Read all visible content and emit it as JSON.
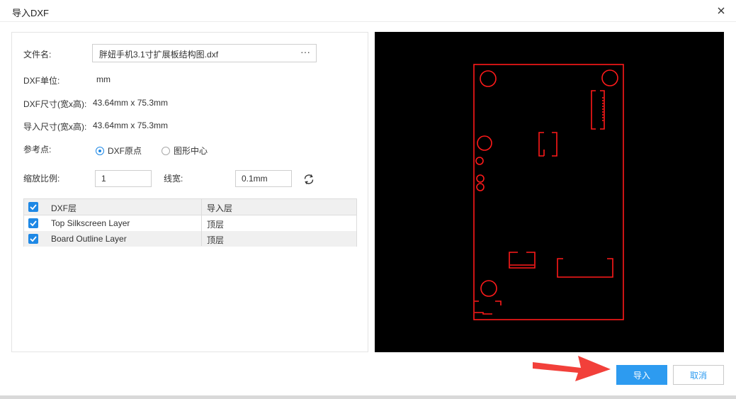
{
  "window": {
    "title": "导入DXF"
  },
  "form": {
    "file_label": "文件名:",
    "file_value": "胖妞手机3.1寸扩展板结构图.dxf",
    "browse_label": "···",
    "unit_label": "DXF单位:",
    "unit_value": "mm",
    "dxf_size_label": "DXF尺寸(宽x高):",
    "dxf_size_value": "43.64mm x 75.3mm",
    "import_size_label": "导入尺寸(宽x高):",
    "import_size_value": "43.64mm x 75.3mm",
    "ref_label": "参考点:",
    "ref_options": [
      "DXF原点",
      "图形中心"
    ],
    "ref_selected": "DXF原点",
    "scale_label": "缩放比例:",
    "scale_value": "1",
    "linewidth_label": "线宽:",
    "linewidth_value": "0.1mm"
  },
  "layers": {
    "headers": [
      "DXF层",
      "导入层"
    ],
    "rows": [
      {
        "dxf_layer": "Top Silkscreen Layer",
        "import_layer": "顶层",
        "checked": true
      },
      {
        "dxf_layer": "Board Outline Layer",
        "import_layer": "顶层",
        "checked": true
      }
    ],
    "all_checked": true
  },
  "preview": {
    "background": "#000000",
    "stroke": "#ff1a1a"
  },
  "buttons": {
    "import_label": "导入",
    "cancel_label": "取消"
  },
  "colors": {
    "accent": "#2d9bf0",
    "arrow": "#f2403a"
  },
  "icons": {
    "close": "close-icon",
    "refresh": "refresh-icon",
    "check": "check-icon"
  }
}
